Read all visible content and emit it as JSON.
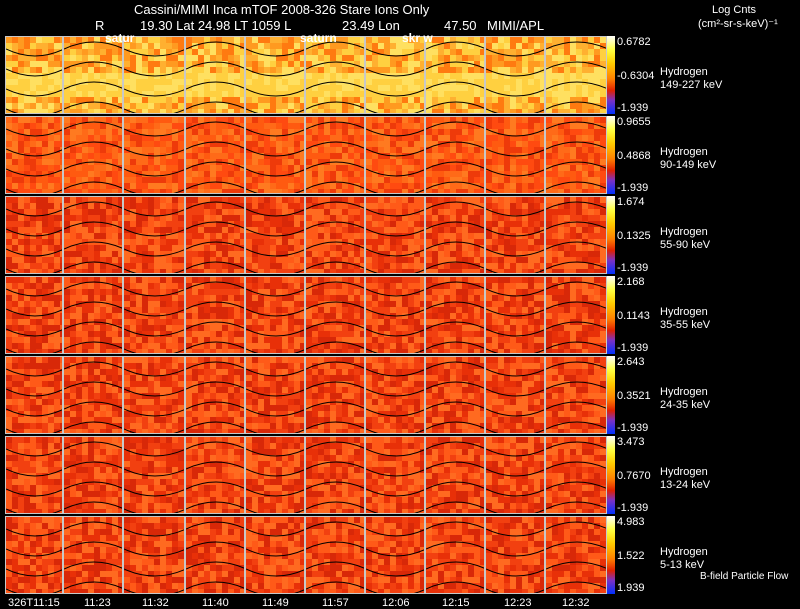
{
  "header": {
    "line1": "Cassini/MIMI Inca mTOF  2008-326   Stare    Ions Only",
    "line2_r_label": "R",
    "line2_r": "19.30 Lat 24.98 LT 1059 L",
    "line2_lon": "23.49 Lon",
    "line2_val": "47.50",
    "line2_src": "MIMI/APL",
    "units_title": "Log Cnts",
    "units": "(cm²-sr-s-keV)⁻¹"
  },
  "saturn_labels": [
    "satur",
    "saturn",
    "skr w"
  ],
  "rows": [
    {
      "species": "Hydrogen",
      "energy": "149-227 keV",
      "max": "0.6782",
      "mid": "-0.6304",
      "min": "-1.939",
      "tone": "hot"
    },
    {
      "species": "Hydrogen",
      "energy": "90-149 keV",
      "max": "0.9655",
      "mid": "0.4868",
      "min": "-1.939",
      "tone": "warm"
    },
    {
      "species": "Hydrogen",
      "energy": "55-90 keV",
      "max": "1.674",
      "mid": "0.1325",
      "min": "-1.939",
      "tone": "red"
    },
    {
      "species": "Hydrogen",
      "energy": "35-55 keV",
      "max": "2.168",
      "mid": "0.1143",
      "min": "-1.939",
      "tone": "red"
    },
    {
      "species": "Hydrogen",
      "energy": "24-35 keV",
      "max": "2.643",
      "mid": "0.3521",
      "min": "-1.939",
      "tone": "red"
    },
    {
      "species": "Hydrogen",
      "energy": "13-24 keV",
      "max": "3.473",
      "mid": "0.7670",
      "min": "-1.939",
      "tone": "red"
    },
    {
      "species": "Hydrogen",
      "energy": "5-13 keV",
      "max": "4.983",
      "mid": "1.522",
      "min": "1.939",
      "tone": "red"
    }
  ],
  "time_ticks": [
    "326T11:15",
    "11:23",
    "11:32",
    "11:40",
    "11:49",
    "11:57",
    "12:06",
    "12:15",
    "12:23",
    "12:32"
  ],
  "footer_label": "B-field Particle Flow",
  "colors": {
    "background": "#000000",
    "grid": "#c8c8c8",
    "contour": "#000000"
  }
}
